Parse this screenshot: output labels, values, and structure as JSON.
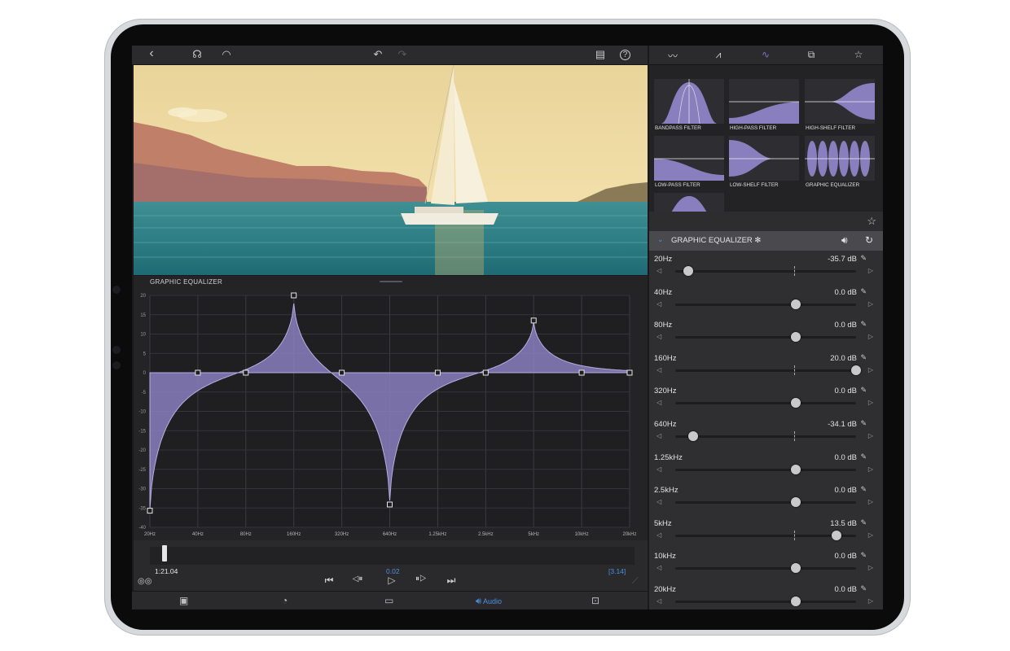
{
  "toolbar": {
    "back": "‹",
    "headphones": "☊",
    "speed": "◠",
    "undo": "↶",
    "redo": "↷",
    "notes": "▤",
    "help": "?"
  },
  "panel_title": "GRAPHIC EQUALIZER",
  "chart_data": {
    "type": "area",
    "title": "GRAPHIC EQUALIZER",
    "categories": [
      "20Hz",
      "40Hz",
      "80Hz",
      "160Hz",
      "320Hz",
      "640Hz",
      "1.25kHz",
      "2.5kHz",
      "5kHz",
      "10kHz",
      "20kHz"
    ],
    "values": [
      -35.7,
      0,
      0,
      20,
      0,
      -34.1,
      0,
      0,
      13.5,
      0,
      0
    ],
    "y_ticks": [
      "20",
      "15",
      "10",
      "5",
      "0",
      "-5",
      "-10",
      "-15",
      "-20",
      "-25",
      "-30",
      "-35",
      "-40"
    ],
    "ylim": [
      -40,
      20
    ],
    "grid": true,
    "fill_color": "#8a7fbe"
  },
  "transport": {
    "current_time": "1:21.04",
    "center_value": "0.02",
    "end_value": "[3.14]",
    "buttons": [
      "⏮",
      "◁⏸",
      "▷",
      "⏸▷",
      "⏭"
    ]
  },
  "bottom_tabs": {
    "audio": "Audio"
  },
  "presets": [
    {
      "label": "BANDPASS FILTER"
    },
    {
      "label": "HIGH-PASS FILTER"
    },
    {
      "label": "HIGH-SHELF FILTER"
    },
    {
      "label": "LOW-PASS FILTER"
    },
    {
      "label": "LOW-SHELF FILTER"
    },
    {
      "label": "GRAPHIC EQUALIZER"
    }
  ],
  "eq_header": {
    "title": "GRAPHIC EQUALIZER ✻"
  },
  "bands": [
    {
      "name": "20Hz",
      "value": "-35.7 dB",
      "level": -35.7
    },
    {
      "name": "40Hz",
      "value": "0.0 dB",
      "level": 0
    },
    {
      "name": "80Hz",
      "value": "0.0 dB",
      "level": 0
    },
    {
      "name": "160Hz",
      "value": "20.0 dB",
      "level": 20
    },
    {
      "name": "320Hz",
      "value": "0.0 dB",
      "level": 0
    },
    {
      "name": "640Hz",
      "value": "-34.1 dB",
      "level": -34.1
    },
    {
      "name": "1.25kHz",
      "value": "0.0 dB",
      "level": 0
    },
    {
      "name": "2.5kHz",
      "value": "0.0 dB",
      "level": 0
    },
    {
      "name": "5kHz",
      "value": "13.5 dB",
      "level": 13.5
    },
    {
      "name": "10kHz",
      "value": "0.0 dB",
      "level": 0
    },
    {
      "name": "20kHz",
      "value": "0.0 dB",
      "level": 0
    }
  ],
  "colors": {
    "accent": "#4a90e2",
    "eq_fill": "#8a7fbe",
    "background": "#1a1a1c"
  }
}
